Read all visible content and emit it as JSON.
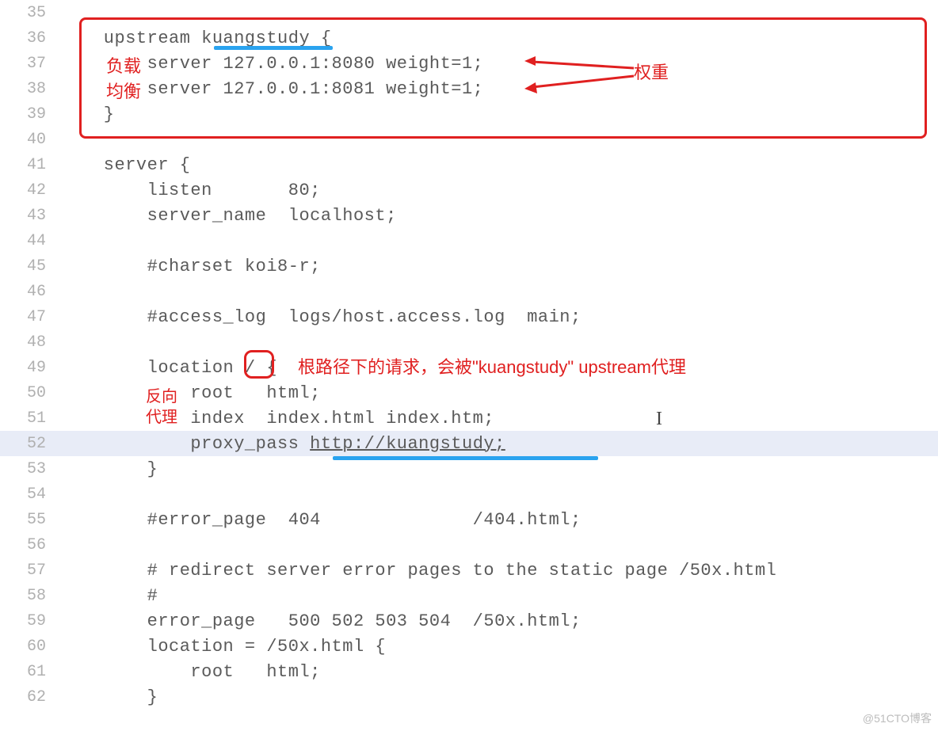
{
  "lines": {
    "l35": "",
    "l36": "    upstream kuangstudy {",
    "l37": "        server 127.0.0.1:8080 weight=1;",
    "l38": "        server 127.0.0.1:8081 weight=1;",
    "l39": "    }",
    "l40": "",
    "l41": "    server {",
    "l42": "        listen       80;",
    "l43": "        server_name  localhost;",
    "l44": "",
    "l45": "        #charset koi8-r;",
    "l46": "",
    "l47": "        #access_log  logs/host.access.log  main;",
    "l48": "",
    "l49": "        location / {",
    "l50": "            root   html;",
    "l51": "            index  index.html index.htm;",
    "l52_a": "            proxy_pass ",
    "l52_b": "http://kuangstudy;",
    "l53": "        }",
    "l54": "",
    "l55": "        #error_page  404              /404.html;",
    "l56": "",
    "l57": "        # redirect server error pages to the static page /50x.html",
    "l58": "        #",
    "l59": "        error_page   500 502 503 504  /50x.html;",
    "l60": "        location = /50x.html {",
    "l61": "            root   html;",
    "l62": "        }"
  },
  "linenos": {
    "n35": "35",
    "n36": "36",
    "n37": "37",
    "n38": "38",
    "n39": "39",
    "n40": "40",
    "n41": "41",
    "n42": "42",
    "n43": "43",
    "n44": "44",
    "n45": "45",
    "n46": "46",
    "n47": "47",
    "n48": "48",
    "n49": "49",
    "n50": "50",
    "n51": "51",
    "n52": "52",
    "n53": "53",
    "n54": "54",
    "n55": "55",
    "n56": "56",
    "n57": "57",
    "n58": "58",
    "n59": "59",
    "n60": "60",
    "n61": "61",
    "n62": "62"
  },
  "annotations": {
    "load1": "负载",
    "load2": "均衡",
    "weight": "权重",
    "rootpath": "根路径下的请求，会被\"kuangstudy\" upstream代理",
    "rev1": "反向",
    "rev2": "代理"
  },
  "watermark": "@51CTO博客"
}
